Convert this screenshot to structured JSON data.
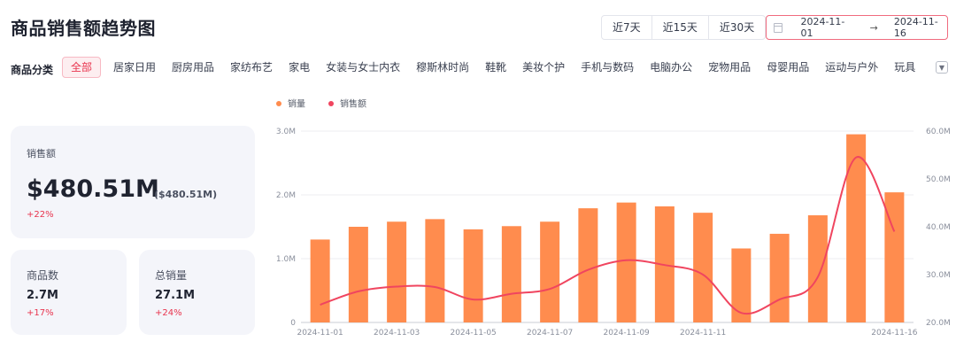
{
  "header": {
    "title": "商品销售额趋势图",
    "ranges": [
      "近7天",
      "近15天",
      "近30天"
    ],
    "date_start": "2024-11-01",
    "date_arrow": "→",
    "date_end": "2024-11-16"
  },
  "categories": {
    "label": "商品分类",
    "items": [
      "全部",
      "居家日用",
      "厨房用品",
      "家纺布艺",
      "家电",
      "女装与女士内衣",
      "穆斯林时尚",
      "鞋靴",
      "美妆个护",
      "手机与数码",
      "电脑办公",
      "宠物用品",
      "母婴用品",
      "运动与户外",
      "玩具"
    ],
    "active": "全部"
  },
  "stats": {
    "sales": {
      "label": "销售额",
      "value": "$480.51M",
      "sub": "($480.51M)",
      "growth": "+22%"
    },
    "products": {
      "label": "商品数",
      "value": "2.7M",
      "growth": "+17%"
    },
    "volume": {
      "label": "总销量",
      "value": "27.1M",
      "growth": "+24%"
    }
  },
  "colors": {
    "accent": "#e8344e",
    "bar": "#ff8c4e",
    "line": "#f0455f"
  },
  "chart_data": {
    "type": "bar",
    "categories": [
      "2024-11-01",
      "2024-11-02",
      "2024-11-03",
      "2024-11-04",
      "2024-11-05",
      "2024-11-06",
      "2024-11-07",
      "2024-11-08",
      "2024-11-09",
      "2024-11-10",
      "2024-11-11",
      "2024-11-12",
      "2024-11-13",
      "2024-11-14",
      "2024-11-15",
      "2024-11-16"
    ],
    "x_tick_labels": [
      "2024-11-01",
      "2024-11-03",
      "2024-11-05",
      "2024-11-07",
      "2024-11-09",
      "2024-11-11",
      "2024-11-16"
    ],
    "series": [
      {
        "name": "销量",
        "type": "bar",
        "axis": "left",
        "values": [
          1.3,
          1.5,
          1.58,
          1.62,
          1.46,
          1.51,
          1.58,
          1.79,
          1.88,
          1.82,
          1.72,
          1.16,
          1.39,
          1.68,
          2.95,
          2.04
        ]
      },
      {
        "name": "销售额",
        "type": "line",
        "axis": "right",
        "values": [
          23.7,
          26.5,
          27.5,
          27.4,
          24.8,
          26.0,
          27.0,
          31.0,
          33.0,
          32.0,
          30.0,
          22.0,
          24.8,
          29.5,
          54.5,
          39.0
        ]
      }
    ],
    "y_left": {
      "min": 0,
      "max": 3,
      "ticks": [
        "0",
        "1.0M",
        "2.0M",
        "3.0M"
      ]
    },
    "y_right": {
      "min": 20,
      "max": 60,
      "ticks": [
        "20.0M",
        "30.0M",
        "40.0M",
        "50.0M",
        "60.0M"
      ]
    },
    "grid": true,
    "legend_position": "top-left"
  }
}
